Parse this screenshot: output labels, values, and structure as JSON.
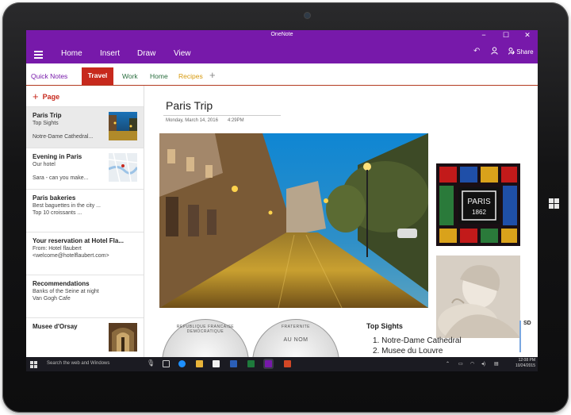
{
  "app": {
    "title": "OneNote"
  },
  "window_controls": {
    "minimize": "−",
    "maximize": "☐",
    "close": "✕"
  },
  "ribbon": {
    "tabs": [
      "Home",
      "Insert",
      "Draw",
      "View"
    ],
    "share_label": "Share"
  },
  "sections": {
    "items": [
      "Quick Notes",
      "Travel",
      "Work",
      "Home",
      "Recipes"
    ],
    "active": "Travel",
    "add_symbol": "+"
  },
  "section_colors": {
    "quick_notes": "#7719aa",
    "travel": "#c7291d",
    "work": "#2a6e3f",
    "home": "#2a6e3f",
    "recipes": "#d79a0e"
  },
  "pages": {
    "add_label": "Page",
    "add_symbol": "+",
    "items": [
      {
        "title": "Paris Trip",
        "lines": [
          "Top Sights",
          "",
          "Notre-Dame Cathedral..."
        ]
      },
      {
        "title": "Evening in Paris",
        "lines": [
          "Our hotel",
          "",
          "Sara - can you make..."
        ]
      },
      {
        "title": "Paris bakeries",
        "lines": [
          "Best baguettes in the city ...",
          "Top 10 croissants ..."
        ]
      },
      {
        "title": "Your reservation at Hotel Fla...",
        "lines": [
          "From: Hotel flaubert",
          "<welcome@hotelflaubert.com>"
        ]
      },
      {
        "title": "Recommendations",
        "lines": [
          "Banks of the Seine at night",
          "Van Gogh Cafe"
        ]
      },
      {
        "title": "Musee d'Orsay",
        "lines": []
      }
    ]
  },
  "page": {
    "title": "Paris Trip",
    "date": "Monday, March 14, 2016",
    "time": "4:29PM",
    "stained_glass_text": [
      "PARIS",
      "1862"
    ],
    "coin_texts": [
      "REPUBLIQUE FRANCAISE DEMOCRATIQUE",
      "FRATERNITE",
      "AU NOM"
    ],
    "sights_heading": "Top Sights",
    "sights": [
      "1. Notre-Dame Cathedral",
      "2. Musee du Louvre"
    ],
    "side_note": "SD"
  },
  "taskbar": {
    "search_placeholder": "Search the web and Windows",
    "time": "12:08 PM",
    "date": "10/24/2015"
  },
  "colors": {
    "titlebar": "#7719aa",
    "accent_red": "#c7291d",
    "taskbar": "#1b1b22"
  }
}
